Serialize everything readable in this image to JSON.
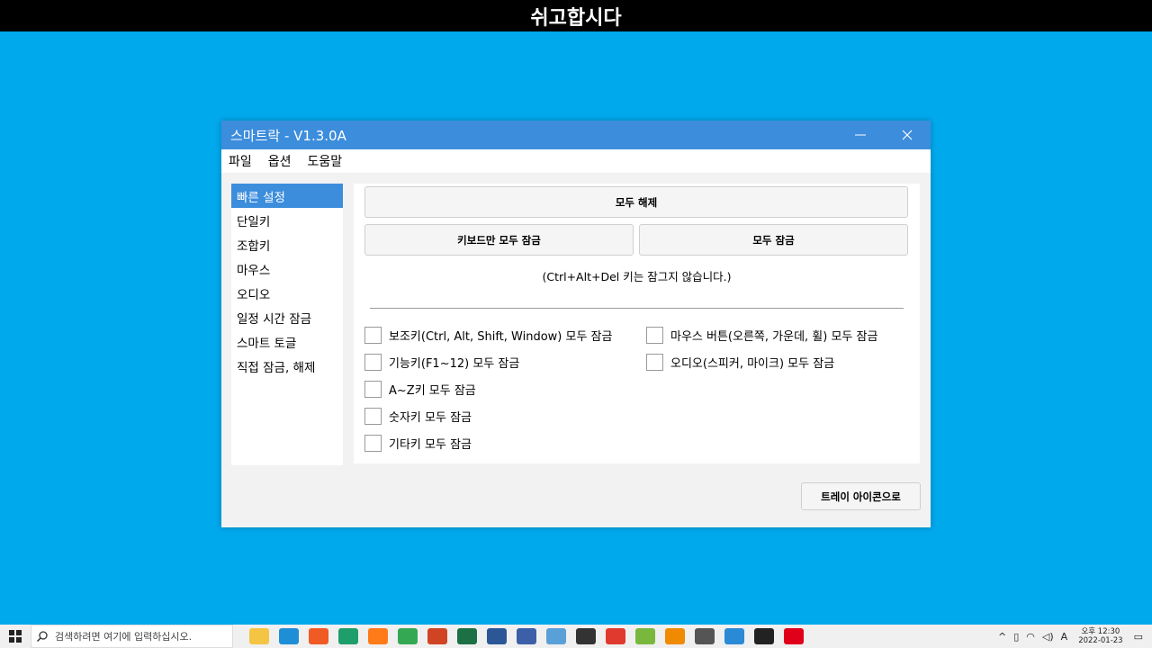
{
  "banner": {
    "text": "쉬고합시다"
  },
  "window": {
    "title": "스마트락 - V1.3.0A",
    "menu": [
      "파일",
      "옵션",
      "도움말"
    ]
  },
  "sidebar": {
    "items": [
      "빠른 설정",
      "단일키",
      "조합키",
      "마우스",
      "오디오",
      "일정 시간 잠금",
      "스마트 토글",
      "직접 잠금, 해제"
    ],
    "active_index": 0
  },
  "quick": {
    "unlock_all": "모두 해제",
    "lock_keyboard_only": "키보드만 모두 잠금",
    "lock_all": "모두 잠금",
    "note": "(Ctrl+Alt+Del 키는 잠그지 않습니다.)",
    "checks_left": [
      "보조키(Ctrl, Alt, Shift, Window) 모두 잠금",
      "기능키(F1~12) 모두 잠금",
      "A~Z키 모두 잠금",
      "숫자키 모두 잠금",
      "기타키 모두 잠금"
    ],
    "checks_right": [
      "마우스 버튼(오른쪽, 가운데, 휠) 모두 잠금",
      "오디오(스피커, 마이크) 모두 잠금"
    ]
  },
  "tray_button": "트레이 아이콘으로",
  "taskbar": {
    "search_placeholder": "검색하려면 여기에 입력하십시오.",
    "apps": [
      {
        "name": "file-explorer-icon",
        "color": "#f4c542"
      },
      {
        "name": "edge-icon",
        "color": "#1e8fd6"
      },
      {
        "name": "brave-icon",
        "color": "#f05a24"
      },
      {
        "name": "app-icon-green",
        "color": "#1e9e6a"
      },
      {
        "name": "firefox-icon",
        "color": "#ff7a18"
      },
      {
        "name": "chrome-icon",
        "color": "#34a853"
      },
      {
        "name": "powerpoint-icon",
        "color": "#d04423"
      },
      {
        "name": "excel-icon",
        "color": "#1d7044"
      },
      {
        "name": "word-icon",
        "color": "#2b5797"
      },
      {
        "name": "calendar-icon",
        "color": "#3c5fa8"
      },
      {
        "name": "remote-desktop-icon",
        "color": "#5aa0d8"
      },
      {
        "name": "search-app-icon",
        "color": "#333333"
      },
      {
        "name": "se-app-icon",
        "color": "#e03a2f"
      },
      {
        "name": "android-icon",
        "color": "#79b83d"
      },
      {
        "name": "vlc-icon",
        "color": "#f08a00"
      },
      {
        "name": "calculator-icon",
        "color": "#555555"
      },
      {
        "name": "chrome-dev-icon",
        "color": "#2b8ad6"
      },
      {
        "name": "sticky-notes-icon",
        "color": "#222222"
      },
      {
        "name": "opera-icon",
        "color": "#e0001a"
      }
    ],
    "ime": "A",
    "time": "오후 12:30",
    "date": "2022-01-23"
  }
}
